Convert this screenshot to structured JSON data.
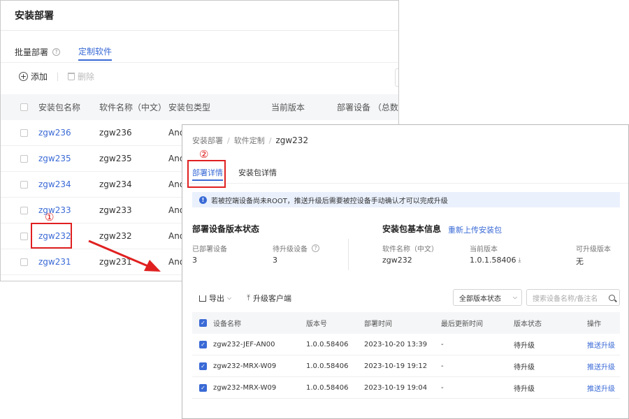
{
  "back": {
    "title": "安装部署",
    "tabs": [
      {
        "label": "批量部署"
      },
      {
        "label": "定制软件"
      }
    ],
    "help_glyph": "?",
    "toolbar": {
      "add_label": "添加",
      "delete_label": "删除",
      "add_glyph": "+"
    },
    "table": {
      "headers": [
        "安装包名称",
        "软件名称（中文）",
        "安装包类型",
        "当前版本",
        "部署设备 （总数)"
      ],
      "rows": [
        {
          "pkg": "zgw236",
          "name": "zgw236",
          "type": "And"
        },
        {
          "pkg": "zgw235",
          "name": "zgw235",
          "type": "And"
        },
        {
          "pkg": "zgw234",
          "name": "zgw234",
          "type": "And"
        },
        {
          "pkg": "zgw233",
          "name": "zgw233",
          "type": "And"
        },
        {
          "pkg": "zgw232",
          "name": "zgw232",
          "type": "And"
        },
        {
          "pkg": "zgw231",
          "name": "zgw231",
          "type": "And"
        }
      ]
    }
  },
  "callouts": {
    "one": "①",
    "two": "②",
    "color": "#e02020"
  },
  "detail": {
    "breadcrumb": [
      "安装部署",
      "软件定制",
      "zgw232"
    ],
    "breadcrumb_sep": "/",
    "tabs": [
      {
        "label": "部署详情"
      },
      {
        "label": "安装包详情"
      }
    ],
    "notice_glyph": "!",
    "notice": "若被控端设备尚未ROOT，推送升级后需要被控设备手动确认才可以完成升级",
    "deploy_section": {
      "title": "部署设备版本状态",
      "deployed_label": "已部署设备",
      "deployed_value": "3",
      "pending_label": "待升级设备",
      "pending_value": "3"
    },
    "package_section": {
      "title": "安装包基本信息",
      "reupload_label": "重新上传安装包",
      "software_name_label": "软件名称（中文）",
      "software_name_value": "zgw232",
      "current_version_label": "当前版本",
      "current_version_value": "1.0.1.58406",
      "download_glyph": "⤓",
      "upgradable_label": "可升级版本",
      "upgradable_value": "无"
    },
    "toolbar": {
      "export_label": "导出",
      "upgrade_label": "升级客户端",
      "upgrade_glyph": "⤒",
      "caret_glyph": "⌵",
      "status_select_value": "全部版本状态",
      "search_placeholder": "搜索设备名称/备注名"
    },
    "table": {
      "headers": [
        "设备名称",
        "版本号",
        "部署时间",
        "最后更新时间",
        "版本状态",
        "操作"
      ],
      "check_glyph": "✓",
      "rows": [
        {
          "device": "zgw232-JEF-AN00",
          "version": "1.0.0.58406",
          "time": "2023-10-20 13:39",
          "updated": "-",
          "status": "待升级",
          "action": "推送升级"
        },
        {
          "device": "zgw232-MRX-W09",
          "version": "1.0.0.58406",
          "time": "2023-10-19 19:12",
          "updated": "-",
          "status": "待升级",
          "action": "推送升级"
        },
        {
          "device": "zgw232-MRX-W09",
          "version": "1.0.0.58406",
          "time": "2023-10-19 19:04",
          "updated": "-",
          "status": "待升级",
          "action": "推送升级"
        }
      ]
    }
  },
  "colors": {
    "accent": "#3a6ad6",
    "callout": "#e02020"
  }
}
